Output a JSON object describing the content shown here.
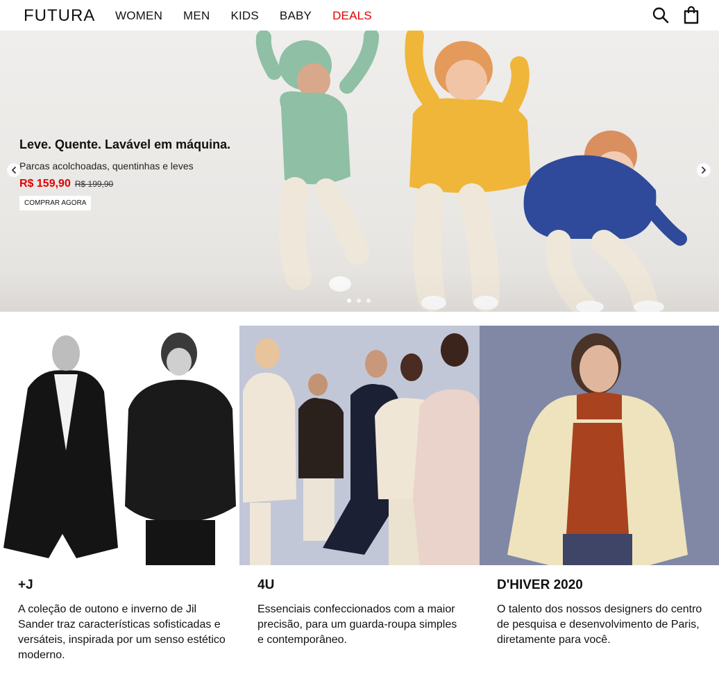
{
  "header": {
    "logo": "FUTURA",
    "nav": [
      "WOMEN",
      "MEN",
      "KIDS",
      "BABY",
      "DEALS"
    ],
    "icons": [
      "search-icon",
      "shopping-bag-icon"
    ]
  },
  "hero": {
    "title": "Leve. Quente. Lavável em máquina.",
    "subtitle": "Parcas acolchoadas, quentinhas e leves",
    "price_now": "R$ 159,90",
    "price_was": "R$ 199,90",
    "cta": "COMPRAR AGORA",
    "slide_count": 3,
    "active_slide": 1
  },
  "collections": [
    {
      "title": "+J",
      "description": "A coleção de outono e inverno de Jil Sander traz características sofisticadas e versáteis, inspirada por um senso estético moderno."
    },
    {
      "title": "4U",
      "description": "Essenciais confeccionados com a maior precisão, para um guarda-roupa simples e contemporâneo."
    },
    {
      "title": "D'HIVER 2020",
      "description": "O talento dos nossos designers do centro de pesquisa e desenvolvimento de Paris, diretamente para você."
    }
  ],
  "colors": {
    "accent_red": "#e00000",
    "text": "#111111",
    "jacket_green": "#8fbfa4",
    "jacket_yellow": "#f0b63a",
    "jacket_blue": "#2f4a9a"
  }
}
